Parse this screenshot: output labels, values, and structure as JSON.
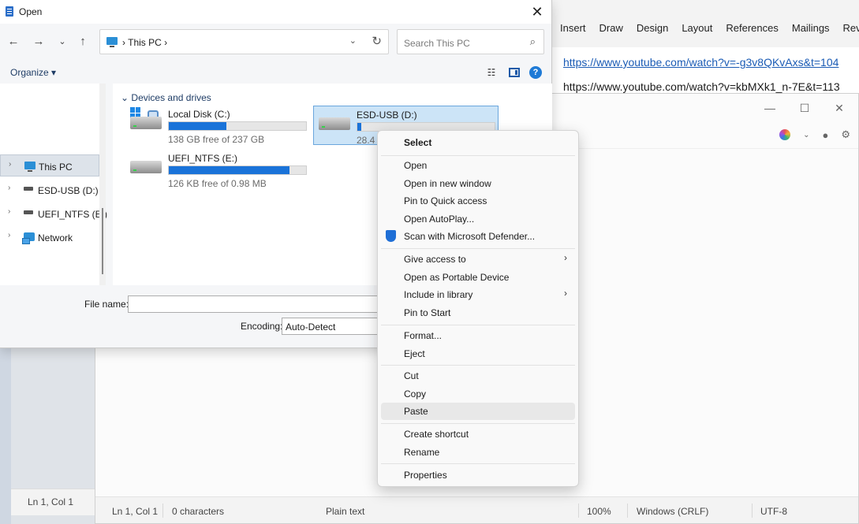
{
  "word": {
    "ribbon_tabs": [
      "Insert",
      "Draw",
      "Design",
      "Layout",
      "References",
      "Mailings",
      "Rev"
    ],
    "links": [
      "https://www.youtube.com/watch?v=-g3v8QKvAxs&t=104",
      "https://www.youtube.com/watch?v=kbMXk1_n-7E&t=113"
    ]
  },
  "notepad": {
    "window_buttons": {
      "minimize": "—",
      "maximize": "☐",
      "close": "✕"
    },
    "status": {
      "position": "Ln 1, Col 1",
      "chars": "0 characters",
      "format": "Plain text",
      "zoom": "100%",
      "line_ending": "Windows (CRLF)",
      "encoding": "UTF-8"
    },
    "old_status_position": "Ln 1, Col 1"
  },
  "dialog": {
    "title": "Open",
    "address": {
      "crumb": "This PC"
    },
    "search_placeholder": "Search This PC",
    "organize_label": "Organize ▾",
    "nav": [
      {
        "label": "This PC",
        "icon": "pc-icon"
      },
      {
        "label": "ESD-USB (D:)",
        "icon": "drive-icon"
      },
      {
        "label": "UEFI_NTFS (E:)",
        "icon": "drive-icon"
      },
      {
        "label": "Network",
        "icon": "network-icon"
      }
    ],
    "group_header": "Devices and drives",
    "drives": [
      {
        "name": "Local Disk (C:)",
        "free": "138 GB free of 237 GB",
        "used_fraction": 0.42
      },
      {
        "name": "ESD-USB (D:)",
        "free": "28.4 C",
        "used_fraction": 0.03
      },
      {
        "name": "UEFI_NTFS (E:)",
        "free": "126 KB free of 0.98 MB",
        "used_fraction": 0.88
      }
    ],
    "file_name_label": "File name:",
    "file_name_value": "",
    "encoding_label": "Encoding:",
    "encoding_value": "Auto-Detect"
  },
  "context_menu": {
    "items": [
      {
        "label": "Select",
        "bold": true
      },
      {
        "label": "Open"
      },
      {
        "label": "Open in new window"
      },
      {
        "label": "Pin to Quick access"
      },
      {
        "label": "Open AutoPlay..."
      },
      {
        "label": "Scan with Microsoft Defender...",
        "icon": "defender-shield-icon"
      },
      {
        "label": "Give access to",
        "submenu": true
      },
      {
        "label": "Open as Portable Device"
      },
      {
        "label": "Include in library",
        "submenu": true
      },
      {
        "label": "Pin to Start"
      },
      {
        "label": "Format..."
      },
      {
        "label": "Eject"
      },
      {
        "label": "Cut"
      },
      {
        "label": "Copy"
      },
      {
        "label": "Paste",
        "hover": true
      },
      {
        "label": "Create shortcut"
      },
      {
        "label": "Rename"
      },
      {
        "label": "Properties"
      }
    ]
  }
}
